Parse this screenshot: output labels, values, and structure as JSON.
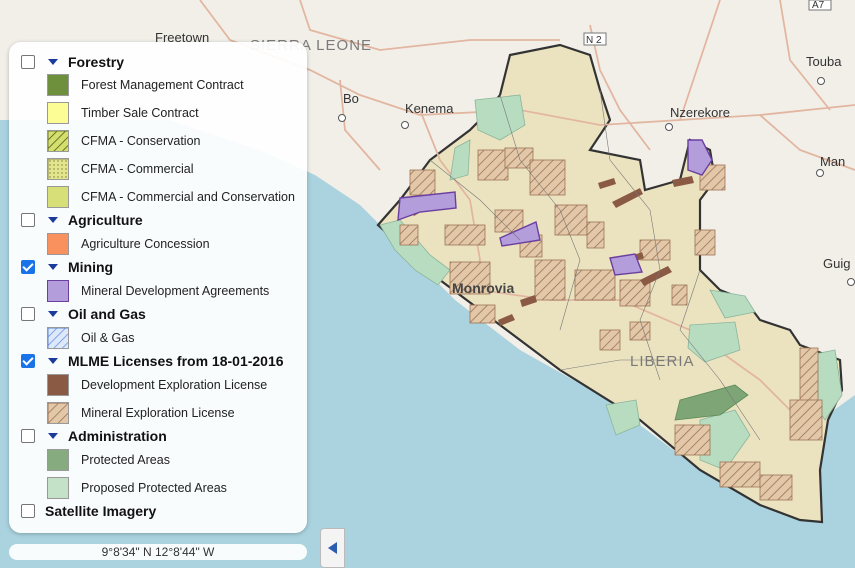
{
  "map": {
    "place_labels": {
      "freetown": "Freetown",
      "sierra_leone": "SIERRA LEONE",
      "bo": "Bo",
      "kenema": "Kenema",
      "nzerekore": "Nzerekore",
      "touba": "Touba",
      "man": "Man",
      "guiglo": "Guig",
      "monrovia": "Monrovia",
      "liberia": "LIBERIA",
      "road_n2": "N 2",
      "road_a7": "A7"
    },
    "colors": {
      "water": "#aad3df",
      "land": "#f2efe9",
      "liberia_land": "#ede6c4",
      "border": "#333333",
      "road": "#e2b6a0"
    }
  },
  "legend": {
    "groups": [
      {
        "title": "Forestry",
        "checked": false,
        "items": [
          {
            "label": "Forest Management Contract",
            "icon": "forest-management-swatch",
            "fill": "#6e8f3c",
            "pattern": "solid"
          },
          {
            "label": "Timber Sale Contract",
            "icon": "timber-sale-swatch",
            "fill": "#fdfd96",
            "pattern": "solid"
          },
          {
            "label": "CFMA - Conservation",
            "icon": "cfma-conservation-swatch",
            "fill": "#bcd04a",
            "pattern": "hatch"
          },
          {
            "label": "CFMA - Commercial",
            "icon": "cfma-commercial-swatch",
            "fill": "#d9de8a",
            "pattern": "dots"
          },
          {
            "label": "CFMA - Commercial and Conservation",
            "icon": "cfma-combined-swatch",
            "fill": "#d7df79",
            "pattern": "solid"
          }
        ]
      },
      {
        "title": "Agriculture",
        "checked": false,
        "items": [
          {
            "label": "Agriculture Concession",
            "icon": "agriculture-swatch",
            "fill": "#f9915e",
            "pattern": "solid"
          }
        ]
      },
      {
        "title": "Mining",
        "checked": true,
        "items": [
          {
            "label": "Mineral Development Agreements",
            "icon": "mineral-development-swatch",
            "fill": "#b39ddb",
            "pattern": "solid"
          }
        ]
      },
      {
        "title": "Oil and Gas",
        "checked": false,
        "items": [
          {
            "label": "Oil & Gas",
            "icon": "oil-gas-swatch",
            "fill": "#c9d9f5",
            "pattern": "bluehatch"
          }
        ]
      },
      {
        "title": "MLME Licenses from 18-01-2016",
        "checked": true,
        "items": [
          {
            "label": "Development Exploration License",
            "icon": "development-exploration-swatch",
            "fill": "#8b5a44",
            "pattern": "solid"
          },
          {
            "label": "Mineral Exploration License",
            "icon": "mineral-exploration-swatch",
            "fill": "#e4cfb4",
            "pattern": "brownhatch"
          }
        ]
      },
      {
        "title": "Administration",
        "checked": false,
        "items": [
          {
            "label": "Protected Areas",
            "icon": "protected-areas-swatch",
            "fill": "#86ab7e",
            "pattern": "solid"
          },
          {
            "label": "Proposed Protected Areas",
            "icon": "proposed-protected-swatch",
            "fill": "#c3e2c8",
            "pattern": "solid"
          }
        ]
      },
      {
        "title": "Satellite Imagery",
        "checked": false,
        "caret": false,
        "items": []
      }
    ]
  },
  "coordinates": "9°8'34\" N  12°8'44\" W",
  "collapse_icon": "collapse-left-arrow-icon"
}
